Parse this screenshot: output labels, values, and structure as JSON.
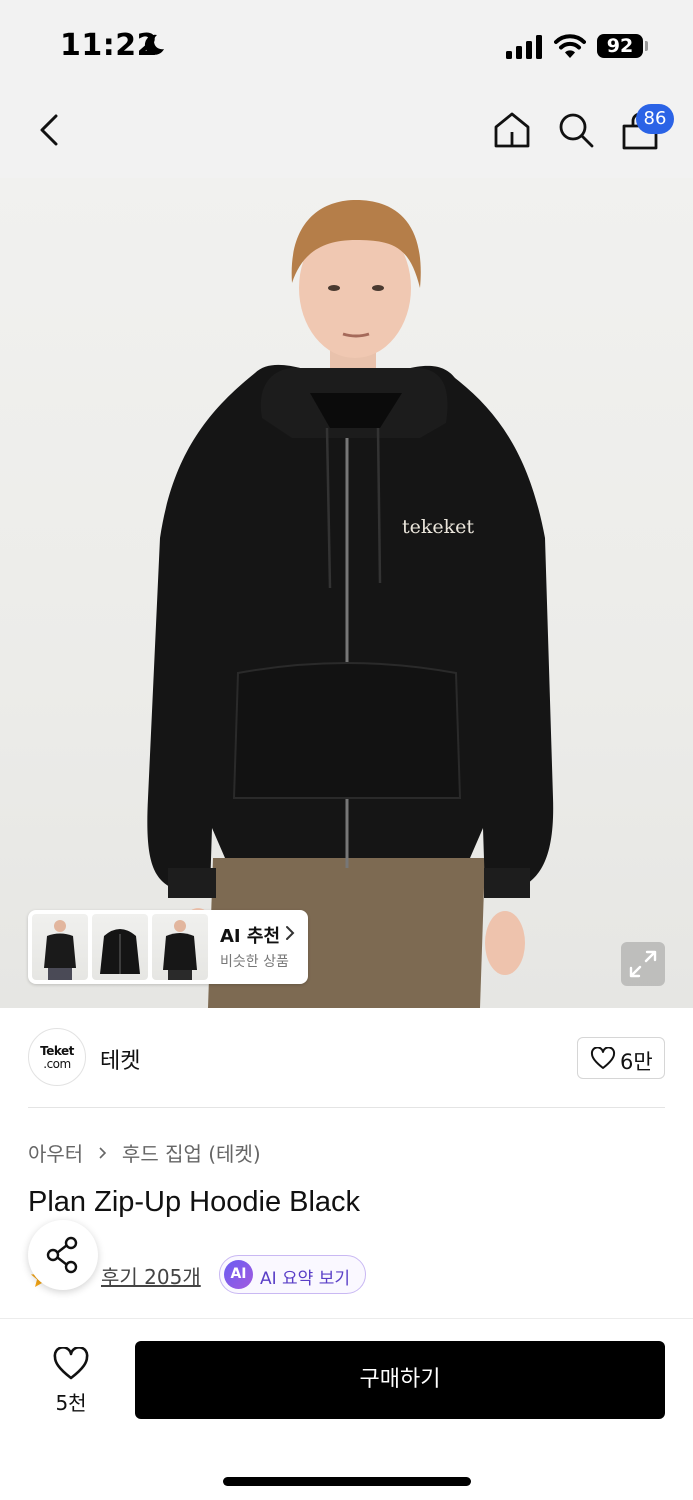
{
  "status_bar": {
    "time": "11:22",
    "battery": "92"
  },
  "nav": {
    "cart_count": "86"
  },
  "colors": {
    "accent_blue": "#2b63e6",
    "buy_button": "#000000",
    "ai_purple": "#5a3fc7"
  },
  "hero": {
    "chest_logo": "tekeket",
    "ai_card": {
      "title": "AI 추천",
      "subtitle": "비슷한 상품"
    }
  },
  "brand": {
    "logo_text_top": "Teket",
    "logo_text_bottom": ".com",
    "name": "테켓",
    "like_count": "6만"
  },
  "breadcrumb": {
    "level1": "아우터",
    "level2": "후드 집업 (테켓)"
  },
  "product": {
    "title": "Plan Zip-Up Hoodie Black",
    "review_link": "후기 205개"
  },
  "ai_summary": {
    "icon_text": "AI",
    "label": "AI 요약 보기"
  },
  "bottom_bar": {
    "wish_count": "5천",
    "buy_label": "구매하기"
  },
  "icons": [
    "moon-icon",
    "signal-icon",
    "wifi-icon",
    "back-icon",
    "home-icon",
    "search-icon",
    "shopping-bag-icon",
    "chevron-right-icon",
    "expand-icon",
    "heart-icon",
    "star-icon",
    "share-icon"
  ]
}
